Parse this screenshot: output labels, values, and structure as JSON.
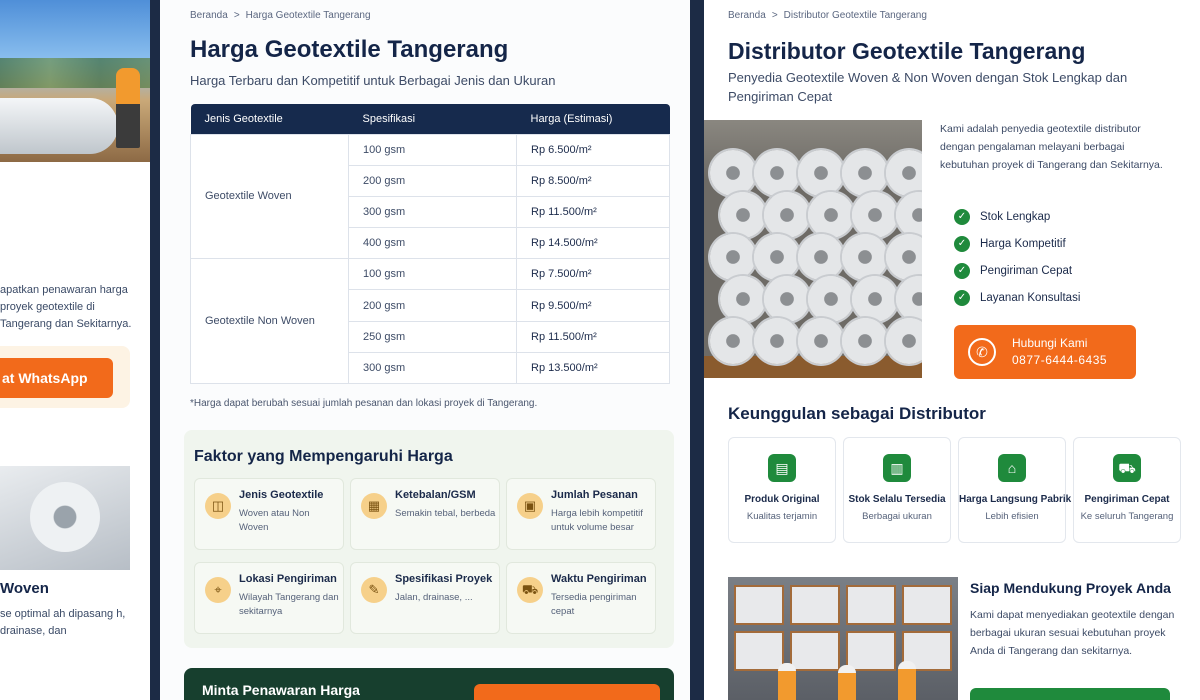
{
  "left": {
    "intro_text": "apatkan penawaran harga proyek geotextile di Tangerang dan Sekitarnya.",
    "whatsapp_label": "at WhatsApp",
    "section_title": "Woven",
    "section_desc": "se optimal ah dipasang h, drainase, dan"
  },
  "middle": {
    "breadcrumb": {
      "home": "Beranda",
      "sep": ">",
      "current": "Harga Geotextile Tangerang"
    },
    "title": "Harga Geotextile Tangerang",
    "subtitle": "Harga Terbaru dan Kompetitif untuk Berbagai Jenis dan Ukuran",
    "table": {
      "headers": [
        "Jenis Geotextile",
        "Spesifikasi",
        "Harga (Estimasi)"
      ],
      "groups": [
        {
          "type": "Geotextile Woven",
          "rows": [
            {
              "spec": "100 gsm",
              "price": "Rp 6.500/m²"
            },
            {
              "spec": "200 gsm",
              "price": "Rp 8.500/m²"
            },
            {
              "spec": "300 gsm",
              "price": "Rp 11.500/m²"
            },
            {
              "spec": "400 gsm",
              "price": "Rp 14.500/m²"
            }
          ]
        },
        {
          "type": "Geotextile Non Woven",
          "rows": [
            {
              "spec": "100 gsm",
              "price": "Rp 7.500/m²"
            },
            {
              "spec": "200 gsm",
              "price": "Rp 9.500/m²"
            },
            {
              "spec": "250 gsm",
              "price": "Rp 11.500/m²"
            },
            {
              "spec": "300 gsm",
              "price": "Rp 13.500/m²"
            }
          ]
        }
      ]
    },
    "note": "*Harga dapat berubah sesuai jumlah pesanan dan lokasi proyek di Tangerang.",
    "factors_title": "Faktor yang Mempengaruhi Harga",
    "factors": [
      {
        "icon": "layers-icon",
        "glyph": "◫",
        "title": "Jenis Geotextile",
        "desc": "Woven atau Non Woven"
      },
      {
        "icon": "ruler-icon",
        "glyph": "▦",
        "title": "Ketebalan/GSM",
        "desc": "Semakin tebal, berbeda"
      },
      {
        "icon": "box-icon",
        "glyph": "▣",
        "title": "Jumlah Pesanan",
        "desc": "Harga lebih kompetitif untuk volume besar"
      },
      {
        "icon": "location-pin-icon",
        "glyph": "⌖",
        "title": "Lokasi Pengiriman",
        "desc": "Wilayah Tangerang dan sekitarnya"
      },
      {
        "icon": "tools-icon",
        "glyph": "✎",
        "title": "Spesifikasi Proyek",
        "desc": "Jalan, drainase, ..."
      },
      {
        "icon": "truck-icon",
        "glyph": "⛟",
        "title": "Waktu Pengiriman",
        "desc": "Tersedia pengiriman cepat"
      }
    ],
    "cta_text": "Minta Penawaran Harga"
  },
  "right": {
    "breadcrumb": {
      "home": "Beranda",
      "sep": ">",
      "current": "Distributor Geotextile Tangerang"
    },
    "title": "Distributor Geotextile Tangerang",
    "subtitle": "Penyedia Geotextile Woven & Non Woven dengan Stok Lengkap dan Pengiriman Cepat",
    "about": "Kami adalah penyedia geotextile distributor dengan pengalaman melayani berbagai kebutuhan proyek di Tangerang dan Sekitarnya.",
    "checks": [
      "Stok Lengkap",
      "Harga Kompetitif",
      "Pengiriman Cepat",
      "Layanan Konsultasi"
    ],
    "call_label": "Hubungi Kami",
    "call_number": "0877-6444-6435",
    "advantages_title": "Keunggulan sebagai Distributor",
    "advantages": [
      {
        "icon": "product-box-icon",
        "glyph": "▤",
        "title": "Produk Original",
        "desc": "Kualitas terjamin"
      },
      {
        "icon": "warehouse-icon",
        "glyph": "▥",
        "title": "Stok Selalu Tersedia",
        "desc": "Berbagai ukuran"
      },
      {
        "icon": "factory-icon",
        "glyph": "⌂",
        "title": "Harga Langsung Pabrik",
        "desc": "Lebih efisien"
      },
      {
        "icon": "delivery-truck-icon",
        "glyph": "⛟",
        "title": "Pengiriman Cepat",
        "desc": "Ke seluruh Tangerang"
      }
    ],
    "ready_title": "Siap Mendukung Proyek Anda",
    "ready_desc": "Kami dapat menyediakan geotextile dengan berbagai ukuran sesuai kebutuhan proyek Anda di Tangerang dan sekitarnya."
  },
  "colors": {
    "navy": "#162a4d",
    "orange": "#f26a1b",
    "green": "#1f8a3c",
    "soft_green": "#f0f5ee"
  }
}
